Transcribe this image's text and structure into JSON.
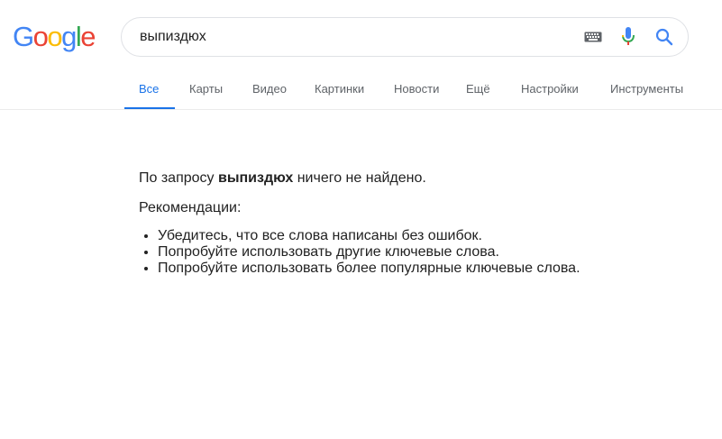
{
  "logo": {
    "letters": [
      "G",
      "o",
      "o",
      "g",
      "l",
      "e"
    ],
    "colors": [
      "#4285f4",
      "#ea4335",
      "#fbbc05",
      "#4285f4",
      "#34a853",
      "#ea4335"
    ]
  },
  "search": {
    "value": "выпиздюх",
    "keyboard_icon": "keyboard-icon",
    "mic_icon": "mic-icon",
    "search_icon": "search-icon"
  },
  "tabs": [
    {
      "label": "Все",
      "active": true
    },
    {
      "label": "Карты",
      "active": false
    },
    {
      "label": "Видео",
      "active": false
    },
    {
      "label": "Картинки",
      "active": false
    },
    {
      "label": "Новости",
      "active": false
    },
    {
      "label": "Ещё",
      "active": false
    },
    {
      "label": "Настройки",
      "active": false
    },
    {
      "label": "Инструменты",
      "active": false
    }
  ],
  "colors": {
    "accent": "#1a73e8",
    "tab_text": "#5f6368",
    "border": "#dfe1e5"
  },
  "results": {
    "no_results_prefix": "По запросу ",
    "query": "выпиздюх",
    "no_results_suffix": " ничего не найдено.",
    "recommendations_title": "Рекомендации:",
    "recommendations": [
      "Убедитесь, что все слова написаны без ошибок.",
      "Попробуйте использовать другие ключевые слова.",
      "Попробуйте использовать более популярные ключевые слова."
    ]
  }
}
